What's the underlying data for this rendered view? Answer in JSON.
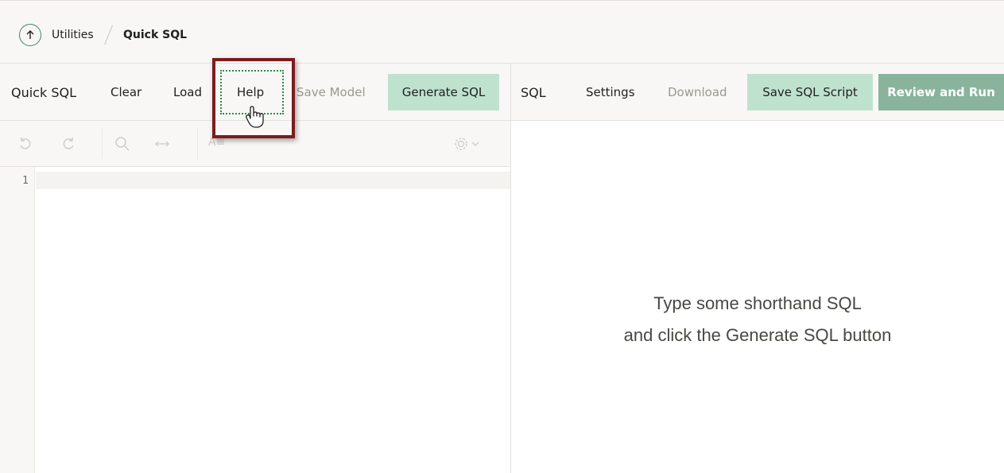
{
  "breadcrumb": {
    "parent": "Utilities",
    "current": "Quick SQL"
  },
  "left_toolbar": {
    "title": "Quick SQL",
    "clear": "Clear",
    "load": "Load",
    "help": "Help",
    "save_model": "Save Model",
    "generate": "Generate SQL"
  },
  "right_toolbar": {
    "title": "SQL",
    "settings": "Settings",
    "download": "Download",
    "save_script": "Save SQL Script",
    "review_run": "Review and Run"
  },
  "editor": {
    "line_number": "1",
    "text_tool": "A≡"
  },
  "output": {
    "line1": "Type some shorthand SQL",
    "line2": "and click the Generate SQL button"
  },
  "colors": {
    "accent_green": "#bfe2cf",
    "run_green": "#89b49b",
    "highlight": "#7b1c1c"
  }
}
